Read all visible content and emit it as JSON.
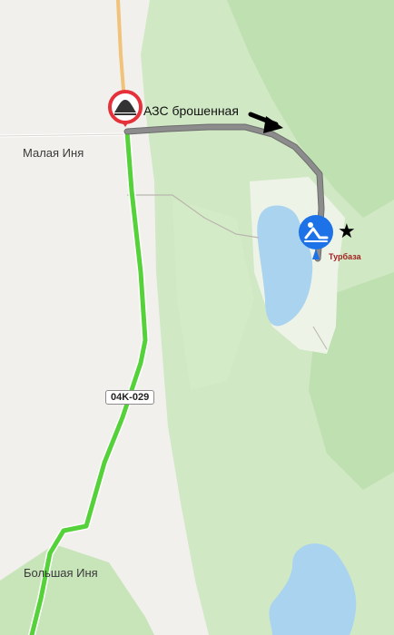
{
  "map": {
    "places": {
      "malaya_inya": "Малая Иня",
      "bolshaya_inya": "Большая Иня"
    },
    "road_number": "04K-029",
    "route_note": "АЗС брошенная",
    "poi_label": "Турбаза",
    "star_glyph": "★",
    "icons": {
      "speed_bump": "speed-bump-warning-icon",
      "poi": "recreation-lounger-icon",
      "arrow": "direction-arrow-icon"
    },
    "colors": {
      "land": "#f1f0ec",
      "forest": "#d0e8c4",
      "forest_dark": "#bfe0b0",
      "water": "#aad3f0",
      "main_road": "#55d23a",
      "route_gray": "#7f7f7f",
      "poi_blue": "#1d72e8",
      "warning_red": "#e5323a",
      "poi_label": "#a32020"
    }
  }
}
